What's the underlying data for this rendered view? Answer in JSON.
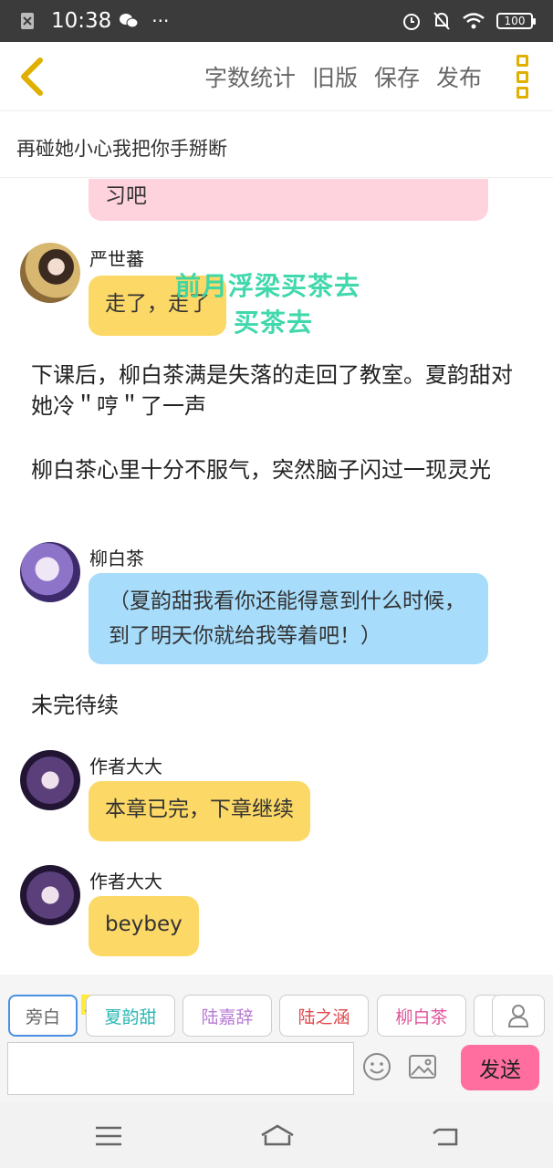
{
  "status_bar": {
    "time": "10:38",
    "dots": "···",
    "battery": "100"
  },
  "toolbar": {
    "word_count": "字数统计",
    "old_version": "旧版",
    "save": "保存",
    "publish": "发布"
  },
  "chapter_title": "再碰她小心我把你手掰断",
  "watermark": {
    "line1": "前月浮梁买茶去",
    "line2": "买茶去"
  },
  "messages": [
    {
      "type": "bubble_partial",
      "color": "#ffd3de",
      "text": "习吧"
    },
    {
      "type": "chat",
      "speaker": "严世蕃",
      "color": "#fcd866",
      "text": "走了，走了"
    },
    {
      "type": "narration",
      "text": "下课后，柳白茶满是失落的走回了教室。夏韵甜对她冷＂哼＂了一声"
    },
    {
      "type": "narration",
      "text": "柳白茶心里十分不服气，突然脑子闪过一现灵光"
    },
    {
      "type": "chat",
      "speaker": "柳白茶",
      "color": "#a7dcfb",
      "text": "（夏韵甜我看你还能得意到什么时候，到了明天你就给我等着吧！）"
    },
    {
      "type": "narration",
      "text": "未完待续"
    },
    {
      "type": "chat",
      "speaker": "作者大大",
      "color": "#fcd866",
      "text": "本章已完，下章继续"
    },
    {
      "type": "chat",
      "speaker": "作者大大",
      "color": "#fcd866",
      "text": "beybey"
    }
  ],
  "characters": {
    "main_tag": "主",
    "chips": [
      {
        "label": "旁白",
        "color": "#666666"
      },
      {
        "label": "夏韵甜",
        "color": "#2bb7b3"
      },
      {
        "label": "陆嘉辞",
        "color": "#b77bd6"
      },
      {
        "label": "陆之涵",
        "color": "#e0474c"
      },
      {
        "label": "柳白茶",
        "color": "#e0559a"
      }
    ]
  },
  "input": {
    "value": "",
    "placeholder": ""
  },
  "send_label": "发送"
}
